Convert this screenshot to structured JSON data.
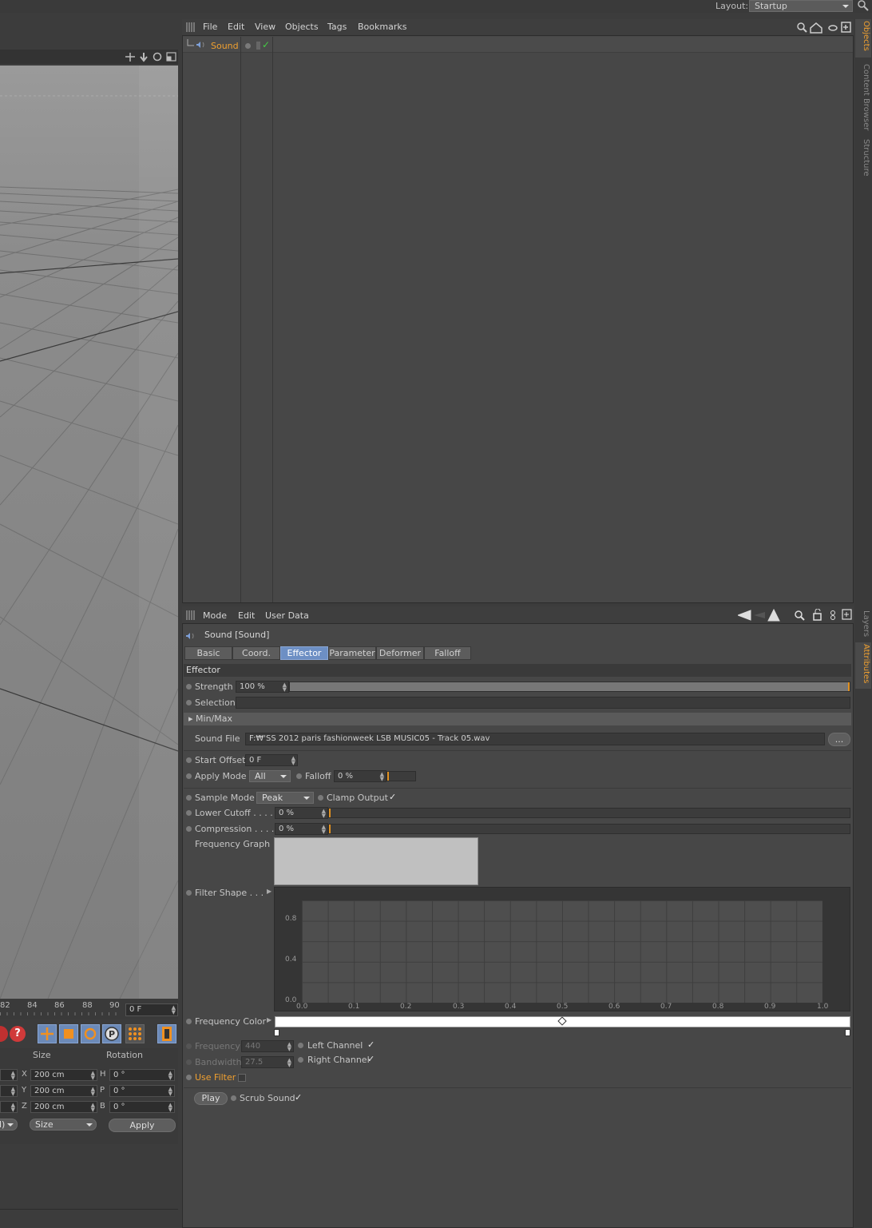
{
  "top": {
    "layout_label": "Layout:",
    "layout_value": "Startup"
  },
  "object_manager": {
    "menus": [
      "File",
      "Edit",
      "View",
      "Objects",
      "Tags",
      "Bookmarks"
    ],
    "object_name": "Sound"
  },
  "side_tabs": {
    "objects": "Objects",
    "content_browser": "Content Browser",
    "structure": "Structure",
    "layers": "Layers",
    "attributes": "Attributes"
  },
  "timeline": {
    "ticks": [
      "82",
      "84",
      "86",
      "88",
      "90"
    ],
    "frame": "0 F"
  },
  "coords": {
    "size_header": "Size",
    "rotation_header": "Rotation",
    "rows": [
      {
        "axis": "X",
        "size": "200 cm",
        "rot_axis": "H",
        "rot": "0 °"
      },
      {
        "axis": "Y",
        "size": "200 cm",
        "rot_axis": "P",
        "rot": "0 °"
      },
      {
        "axis": "Z",
        "size": "200 cm",
        "rot_axis": "B",
        "rot": "0 °"
      }
    ],
    "mode_left": "l)",
    "mode_size": "Size",
    "apply": "Apply"
  },
  "attributes": {
    "menus": [
      "Mode",
      "Edit",
      "User Data"
    ],
    "title": "Sound [Sound]",
    "tabs": [
      "Basic",
      "Coord.",
      "Effector",
      "Parameter",
      "Deformer",
      "Falloff"
    ],
    "active_tab": "Effector",
    "section": "Effector",
    "strength_label": "Strength",
    "strength_value": "100 %",
    "strength_level": 1.0,
    "selection_label": "Selection",
    "minmax_label": "Min/Max",
    "sound_file_label": "Sound File",
    "sound_file_value": "F:₩'SS 2012 paris fashionweek LSB MUSIC05 - Track 05.wav",
    "browse": "...",
    "start_offset_label": "Start Offset",
    "start_offset_value": "0 F",
    "apply_mode_label": "Apply Mode",
    "apply_mode_value": "All",
    "falloff_label": "Falloff",
    "falloff_value": "0 %",
    "sample_mode_label": "Sample Mode",
    "sample_mode_value": "Peak",
    "clamp_label": "Clamp Output",
    "clamp_check": "✓",
    "lower_cutoff_label": "Lower Cutoff . . . . .",
    "lower_cutoff_value": "0 %",
    "compression_label": "Compression . . . . .",
    "compression_value": "0 %",
    "freq_graph_label": "Frequency Graph",
    "filter_shape_label": "Filter Shape . . .",
    "filter_y": [
      "0.8",
      "0.4",
      "0.0"
    ],
    "filter_x": [
      "0.0",
      "0.1",
      "0.2",
      "0.3",
      "0.4",
      "0.5",
      "0.6",
      "0.7",
      "0.8",
      "0.9",
      "1.0"
    ],
    "freq_color_label": "Frequency Color",
    "frequency_label": "Frequency",
    "frequency_value": "440",
    "bandwidth_label": "Bandwidth",
    "bandwidth_value": "27.5",
    "left_channel_label": "Left Channel",
    "left_channel_check": "✓",
    "right_channel_label": "Right Channel",
    "right_channel_check": "✓",
    "use_filter_label": "Use Filter",
    "play": "Play",
    "scrub_label": "Scrub Sound",
    "scrub_check": "✓"
  },
  "colors": {
    "accent": "#f0a030",
    "active_tab": "#6d8fc4",
    "panel": "#474747"
  }
}
